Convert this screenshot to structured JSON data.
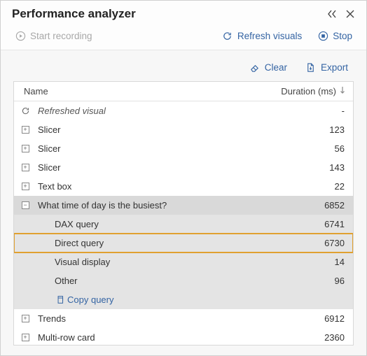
{
  "title": "Performance analyzer",
  "toolbar": {
    "start_recording": "Start recording",
    "refresh_visuals": "Refresh visuals",
    "stop": "Stop"
  },
  "actions": {
    "clear": "Clear",
    "export": "Export"
  },
  "columns": {
    "name": "Name",
    "duration": "Duration (ms)"
  },
  "rows": [
    {
      "type": "refresh",
      "label": "Refreshed visual",
      "duration": "-"
    },
    {
      "type": "collapsed",
      "label": "Slicer",
      "duration": "123"
    },
    {
      "type": "collapsed",
      "label": "Slicer",
      "duration": "56"
    },
    {
      "type": "collapsed",
      "label": "Slicer",
      "duration": "143"
    },
    {
      "type": "collapsed",
      "label": "Text box",
      "duration": "22"
    },
    {
      "type": "expanded",
      "label": "What time of day is the busiest?",
      "duration": "6852"
    },
    {
      "type": "child",
      "label": "DAX query",
      "duration": "6741"
    },
    {
      "type": "child-highlight",
      "label": "Direct query",
      "duration": "6730"
    },
    {
      "type": "child",
      "label": "Visual display",
      "duration": "14"
    },
    {
      "type": "child",
      "label": "Other",
      "duration": "96"
    },
    {
      "type": "copy",
      "label": "Copy query"
    },
    {
      "type": "collapsed",
      "label": "Trends",
      "duration": "6912"
    },
    {
      "type": "collapsed",
      "label": "Multi-row card",
      "duration": "2360"
    }
  ]
}
